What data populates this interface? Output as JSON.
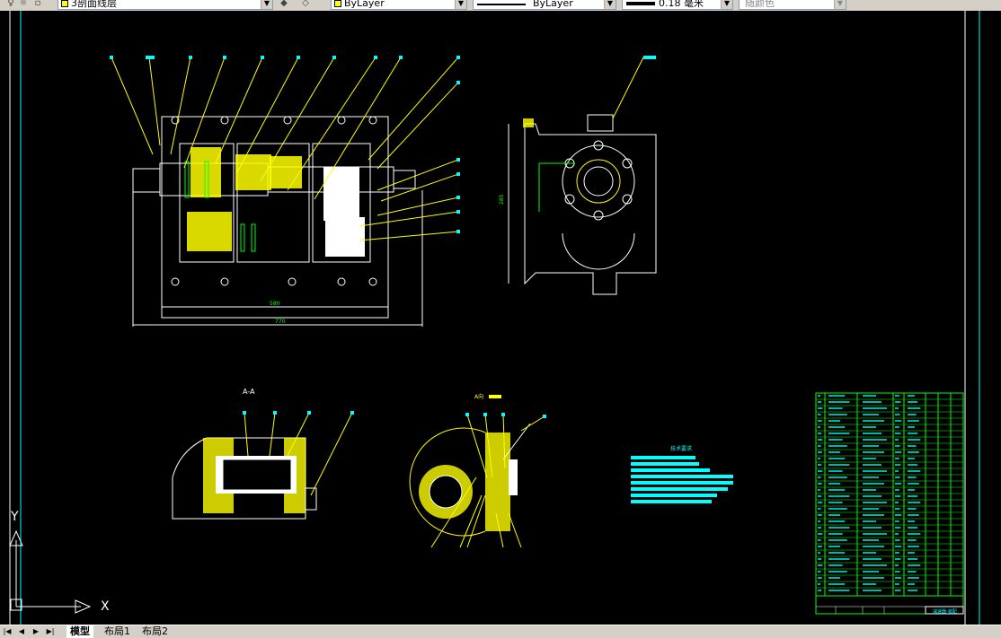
{
  "toolbar": {
    "layer_value": "3剖面线层",
    "color_value": "ByLayer",
    "linetype_value": "ByLayer",
    "lineweight_value": "0.18 毫米",
    "plotstyle_value": "随颜色"
  },
  "drawing": {
    "section_label": "A-A",
    "view_label": "A向",
    "tech_req_title": "技术要求",
    "title_block_name": "减速器-装配",
    "dim_width_inner": "580",
    "dim_width_outer": "770",
    "dim_height_side": "285"
  },
  "ucs": {
    "x_label": "X",
    "y_label": "Y"
  },
  "tabs": {
    "model": "模型",
    "layout1": "布局1",
    "layout2": "布局2"
  },
  "colors": {
    "canvas_bg": "#000000",
    "leader_yellow": "#ffff00",
    "annotation_cyan": "#00ffff",
    "hatch_yellow": "#ffff00",
    "dim_green": "#00ff00",
    "table_green": "#00ff00",
    "geometry_white": "#ffffff"
  }
}
